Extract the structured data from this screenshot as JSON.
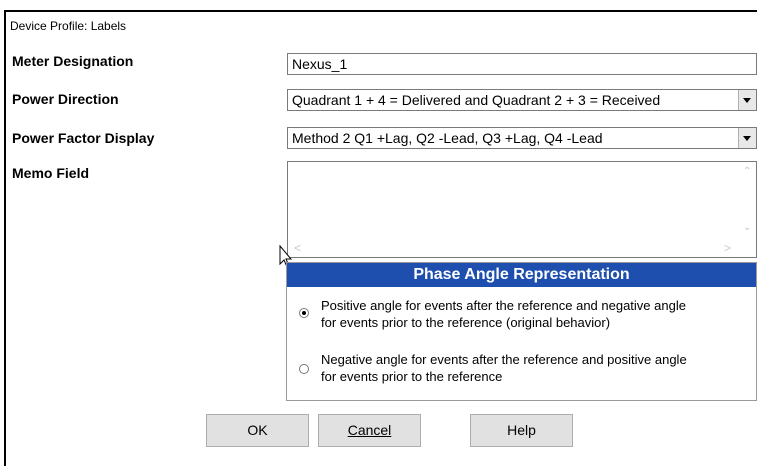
{
  "title": "Device Profile: Labels",
  "fields": {
    "meter_designation": {
      "label": "Meter Designation",
      "value": "Nexus_1"
    },
    "power_direction": {
      "label": "Power Direction",
      "value": "Quadrant 1 + 4 = Delivered  and  Quadrant 2 + 3 = Received"
    },
    "power_factor_display": {
      "label": "Power Factor Display",
      "value": "Method 2 Q1 +Lag, Q2 -Lead, Q3 +Lag, Q4 -Lead"
    },
    "memo_field": {
      "label": "Memo Field",
      "value": ""
    }
  },
  "phase_angle": {
    "header": "Phase Angle Representation",
    "options": [
      {
        "line1": "Positive angle for events after the reference and negative angle",
        "line2": "for events prior to the reference (original behavior)",
        "selected": true
      },
      {
        "line1": "Negative angle for events after the reference and positive angle",
        "line2": "for events prior to the reference",
        "selected": false
      }
    ]
  },
  "buttons": {
    "ok": "OK",
    "cancel": "Cancel",
    "help": "Help"
  },
  "colors": {
    "phase_header_bg": "#1e4fae",
    "phase_header_text": "#ffffff",
    "button_bg": "#e1e1e1"
  },
  "icons": {
    "cursor": "mouse-pointer-icon",
    "dropdown": "chevron-down-icon"
  }
}
